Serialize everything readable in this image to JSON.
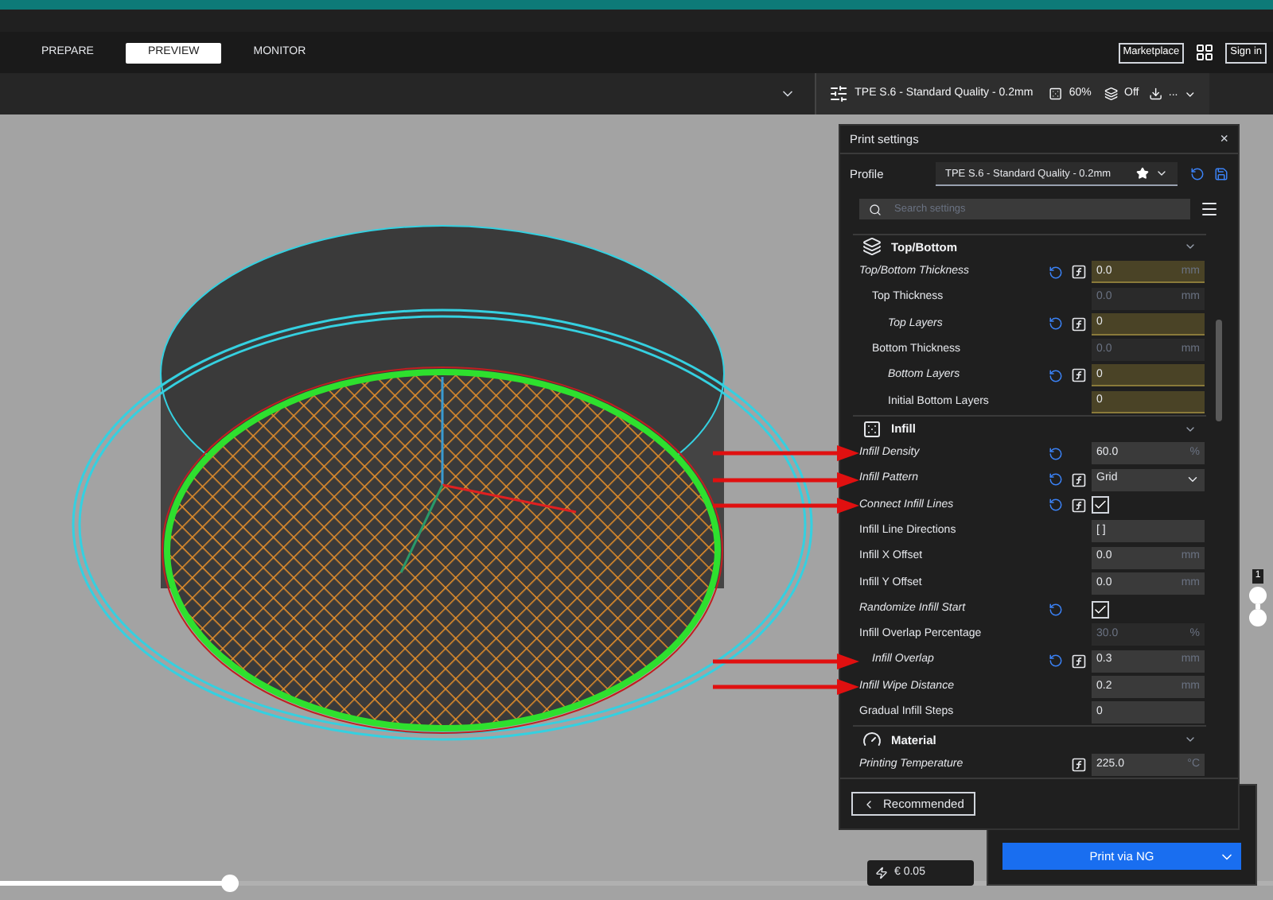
{
  "nav": {
    "tabs": [
      {
        "label": "PREPARE",
        "selected": false
      },
      {
        "label": "PREVIEW",
        "selected": true
      },
      {
        "label": "MONITOR",
        "selected": false
      }
    ],
    "marketplace": "Marketplace",
    "sign_in": "Sign in"
  },
  "toolbar": {
    "profile": "TPE S.6 - Standard Quality - 0.2mm",
    "infill": "60%",
    "adhesion": "Off",
    "more": "..."
  },
  "print_settings": {
    "title": "Print settings",
    "close": "×",
    "profile_label": "Profile",
    "profile_value": "TPE S.6 - Standard Quality - 0.2mm",
    "search_placeholder": "Search settings",
    "categories": [
      {
        "name": "Top/Bottom",
        "settings": [
          {
            "label": "Top/Bottom Thickness",
            "kind": "number",
            "value": "0.0",
            "unit": "mm",
            "overridden": true,
            "reset": true,
            "function": true,
            "disabled": false,
            "highlighted": true,
            "marked": false,
            "children": [
              {
                "label": "Top Thickness",
                "kind": "number",
                "value": "0.0",
                "unit": "mm",
                "overridden": false,
                "reset": false,
                "function": false,
                "disabled": true,
                "highlighted": false,
                "marked": false,
                "children": [
                  {
                    "label": "Top Layers",
                    "kind": "number",
                    "value": "0",
                    "overridden": true,
                    "reset": true,
                    "function": true,
                    "disabled": false,
                    "highlighted": true,
                    "marked": false
                  }
                ]
              },
              {
                "label": "Bottom Thickness",
                "kind": "number",
                "value": "0.0",
                "unit": "mm",
                "overridden": false,
                "reset": false,
                "function": false,
                "disabled": true,
                "highlighted": false,
                "marked": false,
                "children": [
                  {
                    "label": "Bottom Layers",
                    "kind": "number",
                    "value": "0",
                    "overridden": true,
                    "reset": true,
                    "function": true,
                    "disabled": false,
                    "highlighted": true,
                    "marked": false
                  },
                  {
                    "label": "Initial Bottom Layers",
                    "kind": "number",
                    "value": "0",
                    "overridden": false,
                    "reset": false,
                    "function": false,
                    "disabled": false,
                    "highlighted": true,
                    "marked": false
                  }
                ]
              }
            ]
          }
        ]
      },
      {
        "name": "Infill",
        "settings": [
          {
            "label": "Infill Density",
            "kind": "number",
            "value": "60.0",
            "unit": "%",
            "overridden": true,
            "reset": true,
            "function": false,
            "disabled": false,
            "highlighted": false,
            "marked": true
          },
          {
            "label": "Infill Pattern",
            "kind": "dropdown",
            "value": "Grid",
            "overridden": true,
            "reset": true,
            "function": true,
            "disabled": false,
            "highlighted": false,
            "marked": true
          },
          {
            "label": "Connect Infill Lines",
            "kind": "checkbox",
            "checked": true,
            "overridden": true,
            "reset": true,
            "function": true,
            "marked": true
          },
          {
            "label": "Infill Line Directions",
            "kind": "number",
            "value": "[ ]",
            "overridden": false,
            "reset": false,
            "function": false,
            "disabled": false,
            "highlighted": false,
            "marked": false
          },
          {
            "label": "Infill X Offset",
            "kind": "number",
            "value": "0.0",
            "unit": "mm",
            "overridden": false,
            "reset": false,
            "function": false,
            "disabled": false,
            "highlighted": false,
            "marked": false
          },
          {
            "label": "Infill Y Offset",
            "kind": "number",
            "value": "0.0",
            "unit": "mm",
            "overridden": false,
            "reset": false,
            "function": false,
            "disabled": false,
            "highlighted": false,
            "marked": false
          },
          {
            "label": "Randomize Infill Start",
            "kind": "checkbox",
            "checked": true,
            "overridden": true,
            "reset": true,
            "function": false,
            "marked": false
          },
          {
            "label": "Infill Overlap Percentage",
            "kind": "number",
            "value": "30.0",
            "unit": "%",
            "overridden": false,
            "reset": false,
            "function": false,
            "disabled": true,
            "highlighted": false,
            "marked": false,
            "children": [
              {
                "label": "Infill Overlap",
                "kind": "number",
                "value": "0.3",
                "unit": "mm",
                "overridden": true,
                "reset": true,
                "function": true,
                "disabled": false,
                "highlighted": false,
                "marked": true
              }
            ]
          },
          {
            "label": "Infill Wipe Distance",
            "kind": "number",
            "value": "0.2",
            "unit": "mm",
            "overridden": true,
            "reset": false,
            "function": false,
            "disabled": false,
            "highlighted": false,
            "marked": true
          },
          {
            "label": "Gradual Infill Steps",
            "kind": "number",
            "value": "0",
            "overridden": false,
            "reset": false,
            "function": false,
            "disabled": false,
            "highlighted": false,
            "marked": false
          }
        ]
      },
      {
        "name": "Material",
        "settings": [
          {
            "label": "Printing Temperature",
            "kind": "number",
            "value": "225.0",
            "unit": "°C",
            "overridden": true,
            "reset": false,
            "function": true,
            "disabled": false,
            "highlighted": false,
            "marked": false
          }
        ]
      }
    ],
    "recommended": "Recommended"
  },
  "layer_slider": {
    "label": "1"
  },
  "path_slider": {
    "level": 0.18
  },
  "cost": "€ 0.05",
  "print_button": "Print via NG"
}
